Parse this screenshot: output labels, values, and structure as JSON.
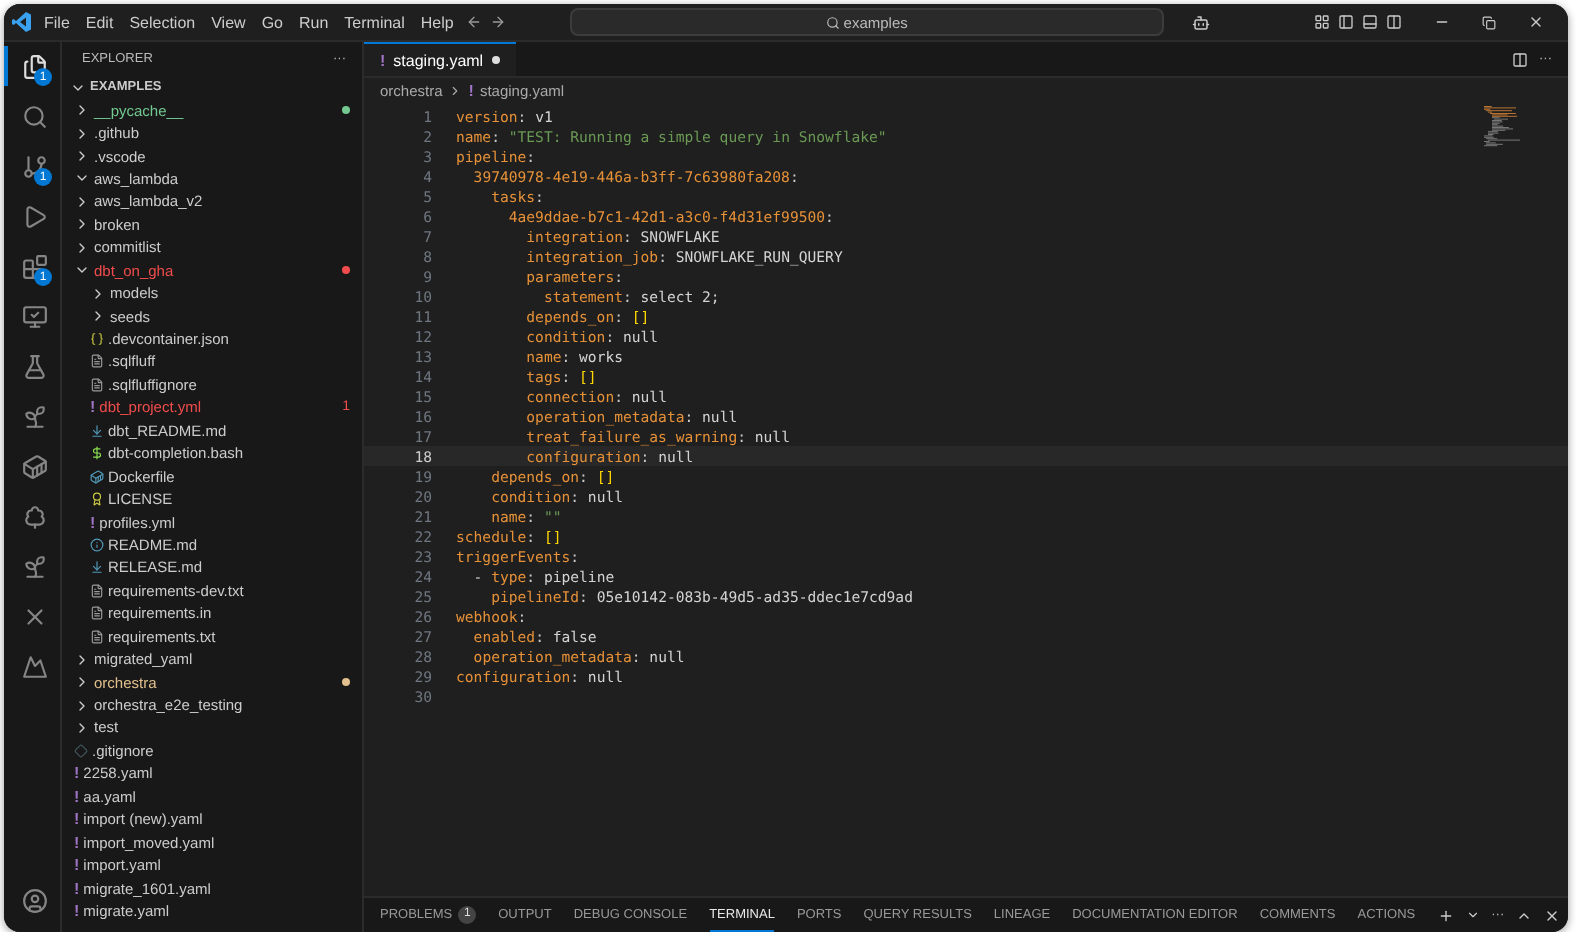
{
  "menu": [
    "File",
    "Edit",
    "Selection",
    "View",
    "Go",
    "Run",
    "Terminal",
    "Help"
  ],
  "search": {
    "value": "examples"
  },
  "activity_bar": [
    {
      "kind": "files",
      "selected": true,
      "badge": "1"
    },
    {
      "kind": "search",
      "selected": false
    },
    {
      "kind": "branch",
      "selected": false,
      "badge": "1"
    },
    {
      "kind": "run",
      "selected": false
    },
    {
      "kind": "blocks",
      "selected": false,
      "badge": "1"
    },
    {
      "kind": "monitor",
      "selected": false
    },
    {
      "kind": "flask",
      "selected": false
    },
    {
      "kind": "sprout",
      "selected": false
    },
    {
      "kind": "whale",
      "selected": false
    },
    {
      "kind": "tree",
      "selected": false
    },
    {
      "kind": "sprout",
      "selected": false
    },
    {
      "kind": "cross",
      "selected": false
    },
    {
      "kind": "peak",
      "selected": false
    }
  ],
  "sidebar": {
    "title": "EXPLORER",
    "more": "···",
    "root": {
      "label": "EXAMPLES",
      "expanded": true
    },
    "items": [
      {
        "label": "__pycache__",
        "kind": "folder",
        "expanded": false,
        "color": "#73c991"
      },
      {
        "label": ".github",
        "kind": "folder",
        "expanded": false
      },
      {
        "label": ".vscode",
        "kind": "folder",
        "expanded": false
      },
      {
        "label": "aws_lambda",
        "kind": "folder",
        "expanded": true
      },
      {
        "label": "aws_lambda_v2",
        "kind": "folder",
        "expanded": false
      },
      {
        "label": "broken",
        "kind": "folder",
        "expanded": false
      },
      {
        "label": "commitlist",
        "kind": "folder",
        "expanded": false
      },
      {
        "label": "dbt_on_gha",
        "kind": "folder",
        "expanded": true,
        "color": "#f14c4c",
        "children": [
          {
            "label": "models",
            "kind": "folder",
            "expanded": false
          },
          {
            "label": "seeds",
            "kind": "folder",
            "expanded": false
          },
          {
            "label": ".devcontainer.json",
            "kind": "json"
          },
          {
            "label": ".sqlfluff",
            "kind": "text"
          },
          {
            "label": ".sqlfluffignore",
            "kind": "text"
          },
          {
            "label": "dbt_project.yml",
            "kind": "yaml",
            "color": "#f14c4c",
            "count": "1"
          },
          {
            "label": "dbt_README.md",
            "kind": "markdown"
          },
          {
            "label": "dbt-completion.bash",
            "kind": "shell"
          },
          {
            "label": "Dockerfile",
            "kind": "docker"
          },
          {
            "label": "LICENSE",
            "kind": "license"
          },
          {
            "label": "profiles.yml",
            "kind": "yaml"
          },
          {
            "label": "README.md",
            "kind": "info"
          },
          {
            "label": "RELEASE.md",
            "kind": "markdown"
          },
          {
            "label": "requirements-dev.txt",
            "kind": "text"
          },
          {
            "label": "requirements.in",
            "kind": "text"
          },
          {
            "label": "requirements.txt",
            "kind": "text"
          }
        ]
      },
      {
        "label": "migrated_yaml",
        "kind": "folder",
        "expanded": false
      },
      {
        "label": "orchestra",
        "kind": "folder",
        "expanded": false,
        "color": "#e2c08d"
      },
      {
        "label": "orchestra_e2e_testing",
        "kind": "folder",
        "expanded": false
      },
      {
        "label": "test",
        "kind": "folder",
        "expanded": false
      },
      {
        "label": ".gitignore",
        "kind": "git"
      },
      {
        "label": "2258.yaml",
        "kind": "yaml"
      },
      {
        "label": "aa.yaml",
        "kind": "yaml"
      },
      {
        "label": "import (new).yaml",
        "kind": "yaml"
      },
      {
        "label": "import_moved.yaml",
        "kind": "yaml"
      },
      {
        "label": "import.yaml",
        "kind": "yaml"
      },
      {
        "label": "migrate_1601.yaml",
        "kind": "yaml"
      },
      {
        "label": "migrate.yaml",
        "kind": "yaml"
      }
    ]
  },
  "editor": {
    "tab": {
      "icon": "!",
      "label": "staging.yaml",
      "dirty": true,
      "selected": true
    },
    "more": "···",
    "breadcrumb": [
      {
        "label": "orchestra"
      },
      {
        "label": "staging.yaml",
        "icon": "!"
      }
    ],
    "lines": [
      {
        "n": "1",
        "current": false,
        "text": "version: v1"
      },
      {
        "n": "2",
        "current": false,
        "text": "name: \"TEST: Running a simple query in Snowflake\""
      },
      {
        "n": "3",
        "current": false,
        "text": "pipeline:"
      },
      {
        "n": "4",
        "current": false,
        "text": "  39740978-4e19-446a-b3ff-7c63980fa208:"
      },
      {
        "n": "5",
        "current": false,
        "text": "    tasks:"
      },
      {
        "n": "6",
        "current": false,
        "text": "      4ae9ddae-b7c1-42d1-a3c0-f4d31ef99500:"
      },
      {
        "n": "7",
        "current": false,
        "text": "        integration: SNOWFLAKE"
      },
      {
        "n": "8",
        "current": false,
        "text": "        integration_job: SNOWFLAKE_RUN_QUERY"
      },
      {
        "n": "9",
        "current": false,
        "text": "        parameters:"
      },
      {
        "n": "10",
        "current": false,
        "text": "          statement: select 2;"
      },
      {
        "n": "11",
        "current": false,
        "text": "        depends_on: []"
      },
      {
        "n": "12",
        "current": false,
        "text": "        condition: null"
      },
      {
        "n": "13",
        "current": false,
        "text": "        name: works"
      },
      {
        "n": "14",
        "current": false,
        "text": "        tags: []"
      },
      {
        "n": "15",
        "current": false,
        "text": "        connection: null"
      },
      {
        "n": "16",
        "current": false,
        "text": "        operation_metadata: null"
      },
      {
        "n": "17",
        "current": false,
        "text": "        treat_failure_as_warning: null"
      },
      {
        "n": "18",
        "current": true,
        "text": "        configuration: null"
      },
      {
        "n": "19",
        "current": false,
        "text": "    depends_on: []"
      },
      {
        "n": "20",
        "current": false,
        "text": "    condition: null"
      },
      {
        "n": "21",
        "current": false,
        "text": "    name: \"\""
      },
      {
        "n": "22",
        "current": false,
        "text": "schedule: []"
      },
      {
        "n": "23",
        "current": false,
        "text": "triggerEvents:"
      },
      {
        "n": "24",
        "current": false,
        "text": "  - type: pipeline"
      },
      {
        "n": "25",
        "current": false,
        "text": "    pipelineId: 05e10142-083b-49d5-ad35-ddec1e7cd9ad"
      },
      {
        "n": "26",
        "current": false,
        "text": "webhook:"
      },
      {
        "n": "27",
        "current": false,
        "text": "  enabled: false"
      },
      {
        "n": "28",
        "current": false,
        "text": "  operation_metadata: null"
      },
      {
        "n": "29",
        "current": false,
        "text": "configuration: null"
      },
      {
        "n": "30",
        "current": false
      }
    ]
  },
  "panel": {
    "tabs": [
      {
        "label": "PROBLEMS",
        "badge": "1",
        "selected": false
      },
      {
        "label": "OUTPUT",
        "selected": false
      },
      {
        "label": "DEBUG CONSOLE",
        "selected": false
      },
      {
        "label": "TERMINAL",
        "selected": true
      },
      {
        "label": "PORTS",
        "selected": false
      },
      {
        "label": "QUERY RESULTS",
        "selected": false
      },
      {
        "label": "LINEAGE",
        "selected": false
      },
      {
        "label": "DOCUMENTATION EDITOR",
        "selected": false
      },
      {
        "label": "COMMENTS",
        "selected": false
      },
      {
        "label": "ACTIONS",
        "selected": false
      }
    ],
    "more": "···"
  }
}
